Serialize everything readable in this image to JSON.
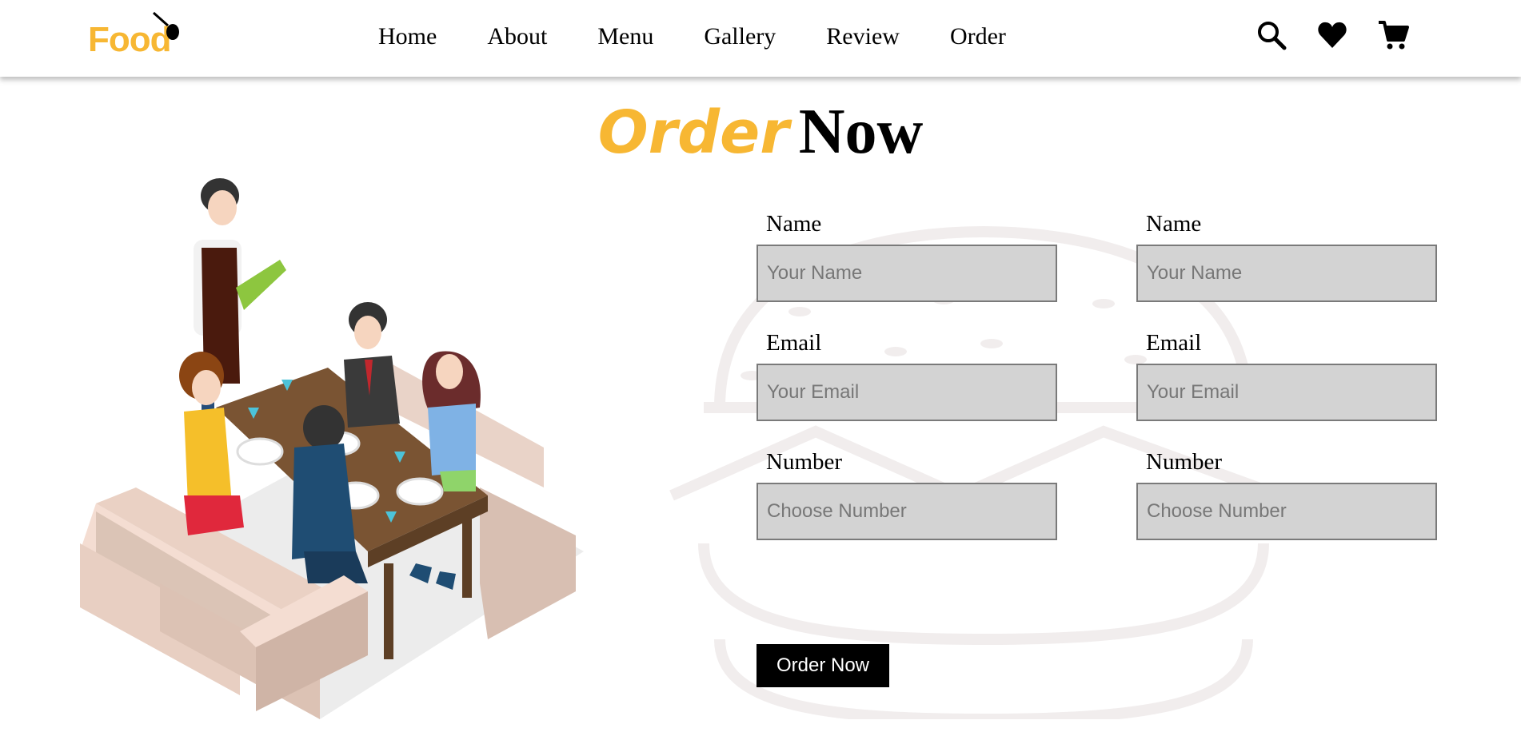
{
  "header": {
    "logo_text_prefix": "Fo",
    "logo_text_suffix": "d",
    "nav": [
      "Home",
      "About",
      "Menu",
      "Gallery",
      "Review",
      "Order"
    ],
    "icons": [
      "search-icon",
      "heart-icon",
      "cart-icon"
    ]
  },
  "section": {
    "title_accent": "Order",
    "title_rest": "Now"
  },
  "form": {
    "left": {
      "name_label": "Name",
      "name_placeholder": "Your Name",
      "email_label": "Email",
      "email_placeholder": "Your Email",
      "number_label": "Number",
      "number_placeholder": "Choose Number"
    },
    "right": {
      "name_label": "Name",
      "name_placeholder": "Your Name",
      "email_label": "Email",
      "email_placeholder": "Your Email",
      "number_label": "Number",
      "number_placeholder": "Choose Number"
    },
    "submit_label": "Order Now"
  },
  "colors": {
    "accent": "#f7b733",
    "input_bg": "#d3d3d3",
    "button_bg": "#000000"
  }
}
